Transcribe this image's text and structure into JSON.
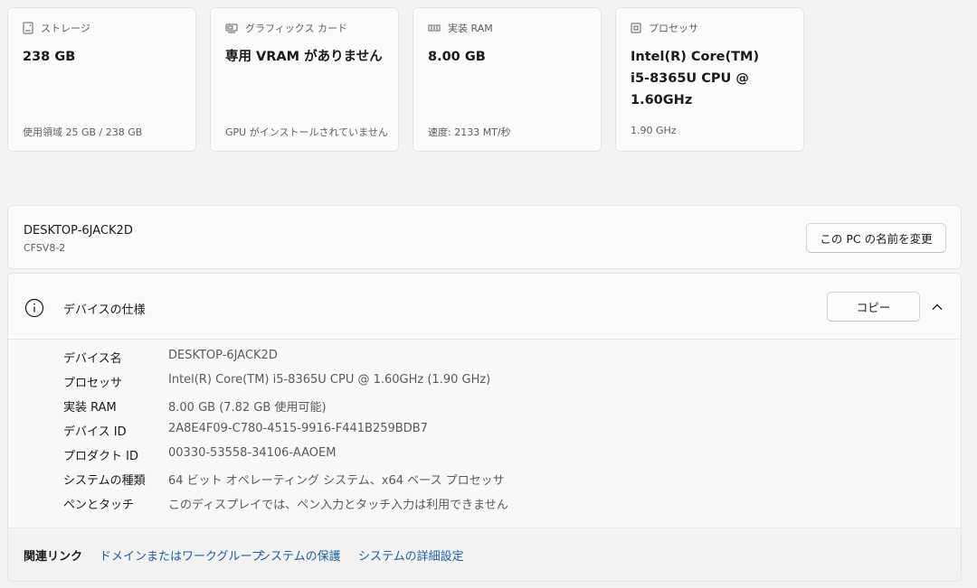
{
  "cards": [
    {
      "icon": "storage-icon",
      "label": "ストレージ",
      "value": "238 GB",
      "sub": "使用領域 25 GB / 238 GB"
    },
    {
      "icon": "graphics-card-icon",
      "label": "グラフィックス カード",
      "value": "専用 VRAM がありません",
      "sub": "GPU がインストールされていません"
    },
    {
      "icon": "memory-icon",
      "label": "実装 RAM",
      "value": "8.00 GB",
      "sub": "速度: 2133 MT/秒"
    },
    {
      "icon": "processor-icon",
      "label": "プロセッサ",
      "value": "Intel(R) Core(TM)\ni5-8365U CPU @\n1.60GHz",
      "sub": "1.90 GHz"
    }
  ],
  "pc": {
    "name": "DESKTOP-6JACK2D",
    "model": "CFSV8-2",
    "rename_label": "この PC の名前を変更"
  },
  "spec": {
    "icon": "info-icon",
    "title": "デバイスの仕様",
    "copy_label": "コピー",
    "rows": [
      {
        "key": "デバイス名",
        "value": "DESKTOP-6JACK2D"
      },
      {
        "key": "プロセッサ",
        "value": "Intel(R) Core(TM) i5-8365U CPU @ 1.60GHz (1.90 GHz)"
      },
      {
        "key": "実装 RAM",
        "value": "8.00 GB (7.82 GB 使用可能)"
      },
      {
        "key": "デバイス ID",
        "value": "2A8E4F09-C780-4515-9916-F441B259BDB7"
      },
      {
        "key": "プロダクト ID",
        "value": "00330-53558-34106-AAOEM"
      },
      {
        "key": "システムの種類",
        "value": "64 ビット オペレーティング システム、x64 ベース プロセッサ"
      },
      {
        "key": "ペンとタッチ",
        "value": "このディスプレイでは、ペン入力とタッチ入力は利用できません"
      }
    ]
  },
  "related": {
    "label": "関連リンク",
    "links": [
      "ドメインまたはワークグループ",
      "システムの保護",
      "システムの詳細設定"
    ]
  },
  "colors": {
    "link": "#1f5ea8",
    "background": "#f3f3f3",
    "card": "#fbfbfb"
  }
}
